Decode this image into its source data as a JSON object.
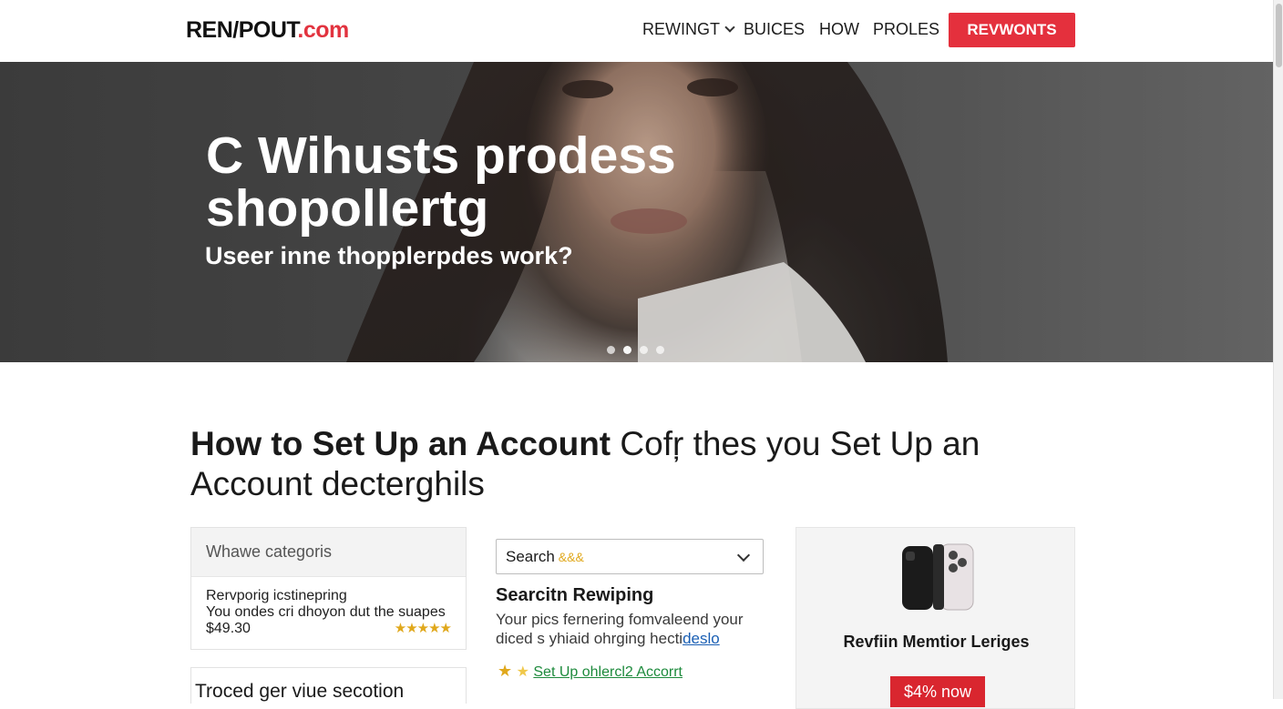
{
  "header": {
    "logo_main": "REN/POUT",
    "logo_tld": ".com",
    "nav": [
      {
        "label": "REWINGT",
        "has_dropdown": true
      },
      {
        "label": "BUICES"
      },
      {
        "label": "HOW"
      },
      {
        "label": "PROLES"
      }
    ],
    "cta_label": "REVWONTS"
  },
  "hero": {
    "title": "C Wihusts prodess shopollertg",
    "subtitle": "Useer inne thopplerpdes work?",
    "dots_count": 4
  },
  "section": {
    "title_bold": "How to Set Up an Account",
    "title_rest": " Cofŗ thes you Set Up an Account decterghils"
  },
  "card_category": {
    "header": "Whawe categoris",
    "line1": "Rervporig icstinepring",
    "line2": "You ondes cri dhoyon dut the suapes",
    "price": "$49.30",
    "stars": "★★★★★"
  },
  "card_next": {
    "title": "Troced ger viue secotion"
  },
  "search": {
    "select_value": "Search",
    "select_extra": " &&&",
    "heading": "Searcitn Rewiping",
    "desc_text": "Your pics fernering fomvaleend your diced s yhiaid ohrging hecti",
    "desc_link": "deslo",
    "link_stars": "★ ★",
    "link_label": "Set Up ohlercl2 Accorrt"
  },
  "product": {
    "icon": "smartphone-icon",
    "title": "Revfiin Memtior Leriges",
    "button_label": "$4% now"
  },
  "colors": {
    "brand_red": "#e4303d",
    "star_gold": "#e0a81c",
    "link_green": "#1d8a3c"
  }
}
